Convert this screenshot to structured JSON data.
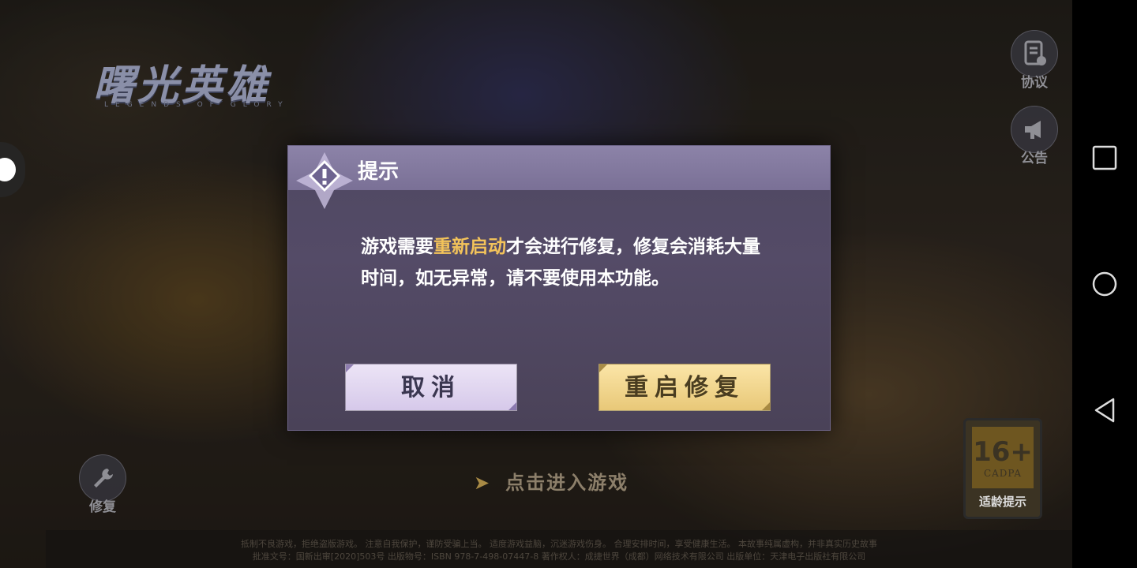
{
  "game": {
    "logo_text": "曙光英雄",
    "logo_sub": "LEGENDS OF GLORY",
    "enter_label": "点击进入游戏",
    "footer_line1": "抵制不良游戏，拒绝盗版游戏。 注意自我保护，谨防受骗上当。 适度游戏益脑，沉迷游戏伤身。 合理安排时间，享受健康生活。 本故事纯属虚构，并非真实历史故事",
    "footer_line2": "批准文号：国新出审[2020]503号 出版物号：ISBN 978-7-498-07447-8 著作权人：成捷世界（成都）网络技术有限公司 出版单位：天津电子出版社有限公司"
  },
  "side_buttons": {
    "agreement": "协议",
    "announcement": "公告",
    "repair": "修复"
  },
  "age_rating": {
    "number": "16+",
    "org": "CADPA",
    "tip": "适龄提示"
  },
  "dialog": {
    "title": "提示",
    "message_before": "游戏需要",
    "message_highlight": "重新启动",
    "message_after": "才会进行修复，修复会消耗大量时间，如无异常，请不要使用本功能。",
    "cancel_label": "取消",
    "confirm_label": "重启修复",
    "highlight_color": "#f3c35a"
  },
  "system_nav": {
    "icons": [
      "recents-icon",
      "home-icon",
      "back-icon"
    ]
  }
}
